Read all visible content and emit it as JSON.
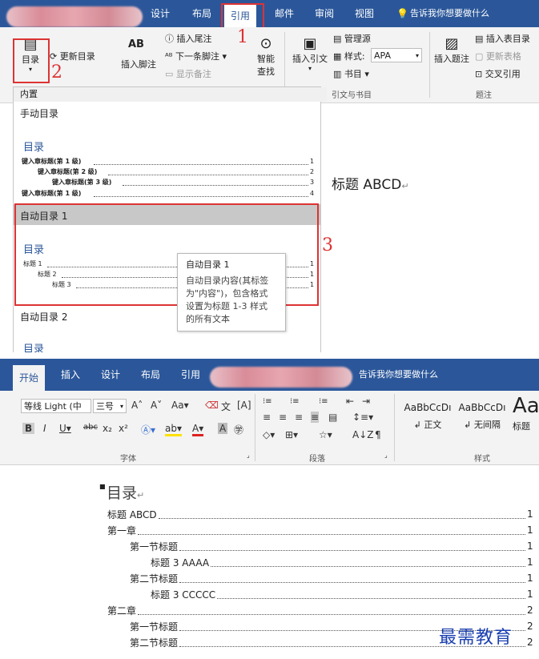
{
  "top": {
    "tabs": [
      {
        "label": "设计"
      },
      {
        "label": "布局"
      },
      {
        "label": "引用"
      },
      {
        "label": "邮件"
      },
      {
        "label": "审阅"
      },
      {
        "label": "视图"
      }
    ],
    "tell_me": "告诉我你想要做什么",
    "ribbon": {
      "toc_button": "目录",
      "update_toc": "更新目录",
      "insert_footnote_ab": "AB",
      "insert_footnote": "插入脚注",
      "insert_endnote": "插入尾注",
      "next_footnote": "下一条脚注",
      "show_notes": "显示备注",
      "smart_lookup_1": "智能",
      "smart_lookup_2": "查找",
      "insert_citation": "插入引文",
      "manage_sources": "管理源",
      "style_label": "样式:",
      "style_value": "APA",
      "bibliography": "书目",
      "group_citations": "引文与书目",
      "insert_caption": "插入题注",
      "insert_table_of_figures": "插入表目录",
      "update_table": "更新表格",
      "cross_reference": "交叉引用",
      "group_captions": "题注"
    },
    "annotations": {
      "n1": "1",
      "n2": "2",
      "n3": "3"
    },
    "gallery": {
      "section_builtin": "内置",
      "manual_toc": "手动目录",
      "manual_heading": "目录",
      "manual_lines": [
        {
          "text": "键入章标题(第 1 级)",
          "num": "1"
        },
        {
          "text": "键入章标题(第 2 级)",
          "num": "2"
        },
        {
          "text": "键入章标题(第 3 级)",
          "num": "3"
        },
        {
          "text": "键入章标题(第 1 级)",
          "num": "4"
        }
      ],
      "auto_toc_1": "自动目录 1",
      "auto_heading": "目录",
      "auto_lines": [
        {
          "text": "标题 1",
          "num": "1"
        },
        {
          "text": "标题 2",
          "num": "1"
        },
        {
          "text": "标题 3",
          "num": "1"
        }
      ],
      "auto_toc_2": "自动目录 2",
      "auto2_heading": "目录"
    },
    "tooltip": {
      "title": "自动目录 1",
      "line1": "自动目录内容(其标签",
      "line2": "为\"内容\")，包含格式",
      "line3": "设置为标题 1-3 样式",
      "line4": "的所有文本"
    },
    "doc_heading": "标题 ABCD"
  },
  "bottom": {
    "tabs": [
      {
        "label": "开始"
      },
      {
        "label": "插入"
      },
      {
        "label": "设计"
      },
      {
        "label": "布局"
      },
      {
        "label": "引用"
      }
    ],
    "tell_me": "告诉我你想要做什么",
    "font_name": "等线 Light (中",
    "font_size": "三号",
    "group_font": "字体",
    "group_paragraph": "段落",
    "group_styles": "样式",
    "styles": [
      {
        "preview": "AaBbCcDı",
        "name": "正文"
      },
      {
        "preview": "AaBbCcDı",
        "name": "无间隔"
      },
      {
        "preview": "Aa",
        "name": "标题"
      }
    ],
    "toc_title": "目录",
    "toc": [
      {
        "text": "标题 ABCD",
        "level": 1,
        "page": "1"
      },
      {
        "text": "第一章",
        "level": 1,
        "page": "1"
      },
      {
        "text": "第一节标题",
        "level": 2,
        "page": "1"
      },
      {
        "text": "标题 3 AAAA",
        "level": 3,
        "page": "1"
      },
      {
        "text": "第二节标题",
        "level": 2,
        "page": "1"
      },
      {
        "text": "标题 3 CCCCC",
        "level": 3,
        "page": "1"
      },
      {
        "text": "第二章",
        "level": 1,
        "page": "2"
      },
      {
        "text": "第一节标题",
        "level": 2,
        "page": "2"
      },
      {
        "text": "第二节标题",
        "level": 2,
        "page": "2"
      }
    ]
  },
  "watermark": "最需教育",
  "colors": {
    "word_blue": "#2b579a",
    "annotation_red": "#d33333",
    "watermark_blue": "#1a3fb0"
  }
}
